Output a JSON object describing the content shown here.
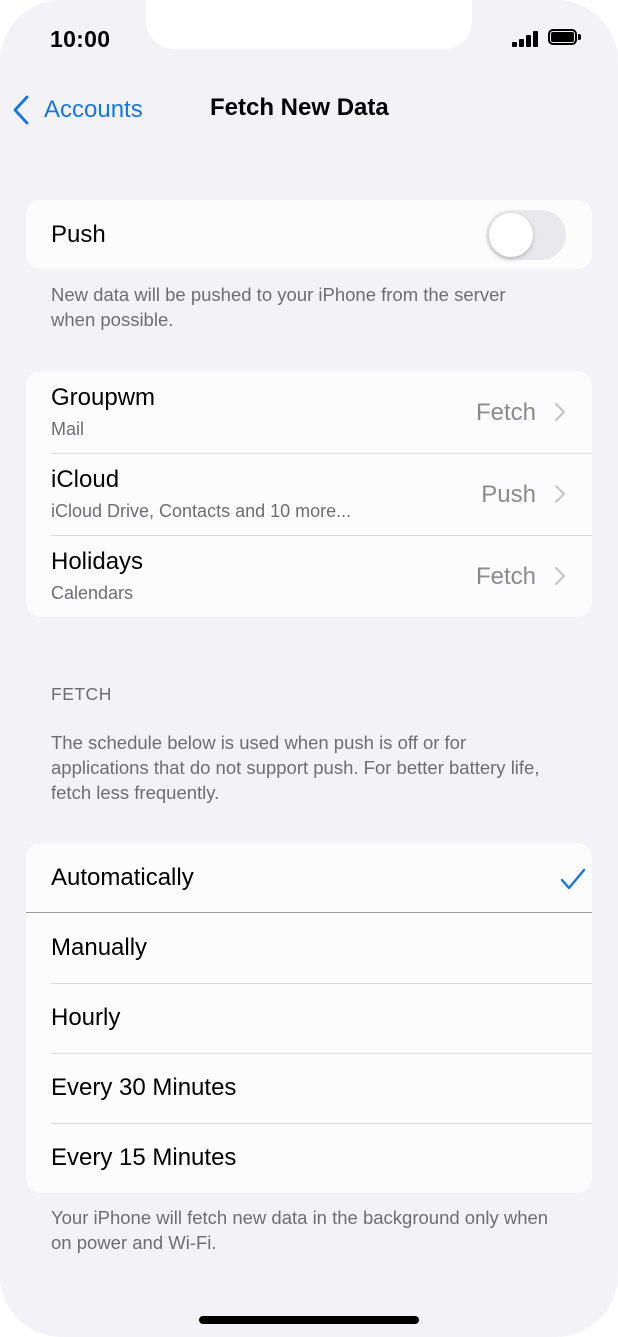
{
  "status_bar": {
    "time": "10:00"
  },
  "nav": {
    "back_label": "Accounts",
    "title": "Fetch New Data"
  },
  "push": {
    "label": "Push",
    "enabled": false,
    "footer": "New data will be pushed to your iPhone from the server when possible."
  },
  "accounts": [
    {
      "name": "Groupwm",
      "detail": "Mail",
      "mode": "Fetch"
    },
    {
      "name": "iCloud",
      "detail": "iCloud Drive, Contacts and 10 more...",
      "mode": "Push"
    },
    {
      "name": "Holidays",
      "detail": "Calendars",
      "mode": "Fetch"
    }
  ],
  "fetch": {
    "header": "FETCH",
    "description": "The schedule below is used when push is off or for applications that do not support push. For better battery life, fetch less frequently.",
    "options": [
      {
        "label": "Automatically",
        "selected": true
      },
      {
        "label": "Manually",
        "selected": false
      },
      {
        "label": "Hourly",
        "selected": false
      },
      {
        "label": "Every 30 Minutes",
        "selected": false
      },
      {
        "label": "Every 15 Minutes",
        "selected": false
      }
    ],
    "footer": "Your iPhone will fetch new data in the background only when on power and Wi-Fi."
  },
  "colors": {
    "accent": "#1476e8",
    "background": "#f2f2f7",
    "cell": "#fcfcfd",
    "secondary_text": "#6d6d72"
  }
}
